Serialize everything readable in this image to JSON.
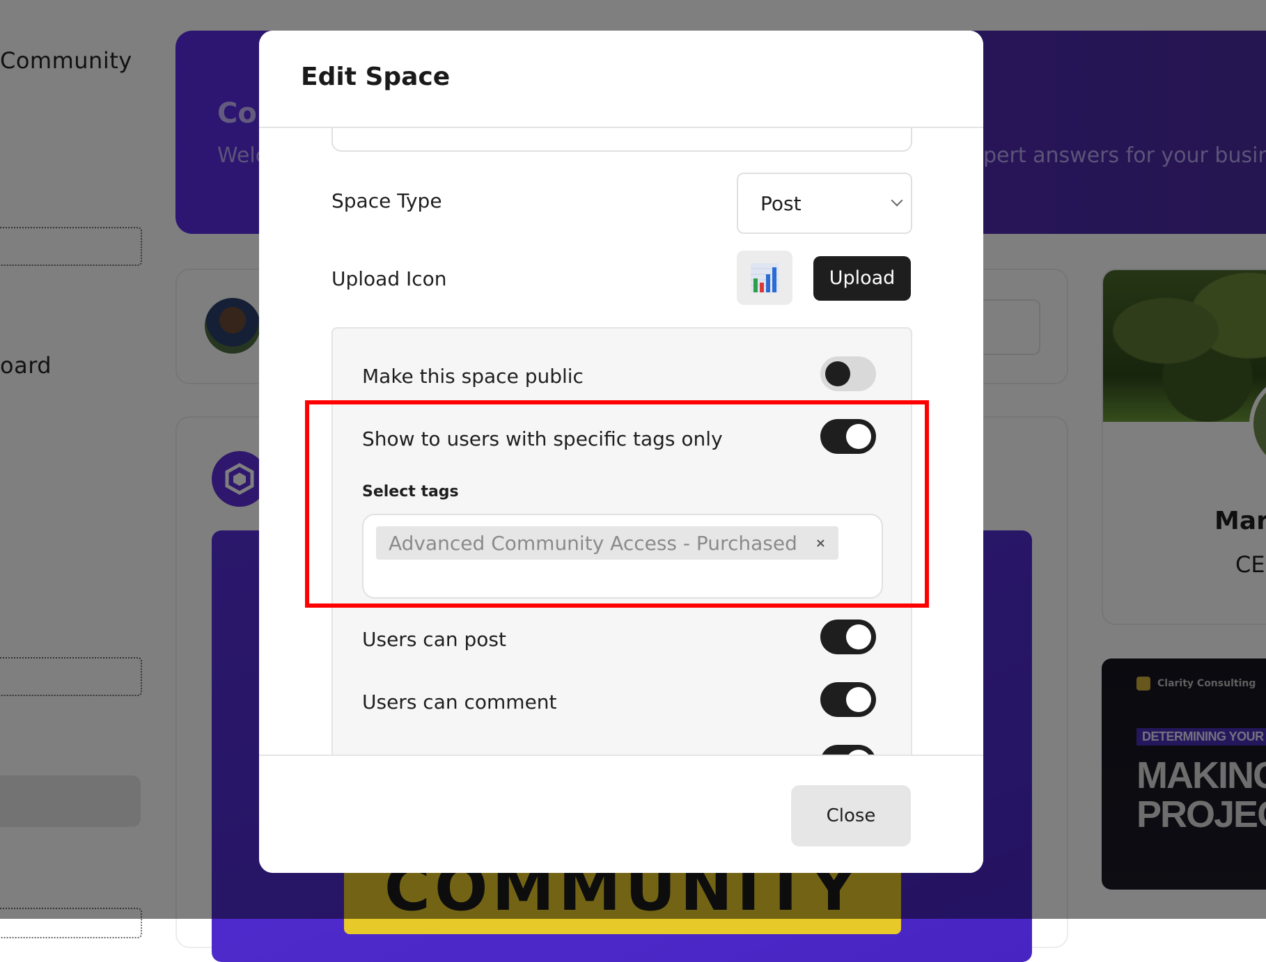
{
  "background": {
    "sidebar": {
      "community_label": "Community",
      "board_label": "oard"
    },
    "banner": {
      "title": "Co",
      "subtitle_left": "Welc",
      "subtitle_right": "pert answers for your busines"
    },
    "profile_card": {
      "name": "Marc",
      "role": "CEO"
    },
    "promo_card": {
      "brand": "Clarity Consulting",
      "tag": "DETERMINING YOUR BUSIN",
      "headline_line1": "MAKING R",
      "headline_line2": "PROJECTIO"
    },
    "yellow_bar_text": "COMMUNITY"
  },
  "modal": {
    "title": "Edit Space",
    "space_type": {
      "label": "Space Type",
      "value": "Post"
    },
    "upload_icon": {
      "label": "Upload Icon",
      "button_label": "Upload"
    },
    "toggles": [
      {
        "label": "Make this space public",
        "state": "off"
      },
      {
        "label": "Show to users with specific tags only",
        "state": "on"
      },
      {
        "label": "Users can post",
        "state": "on"
      },
      {
        "label": "Users can comment",
        "state": "on"
      }
    ],
    "select_tags": {
      "label": "Select tags",
      "selected": [
        "Advanced Community Access - Purchased"
      ],
      "remove_glyph": "×"
    },
    "footer": {
      "close_label": "Close"
    }
  },
  "colors": {
    "highlight": "#ff0000",
    "banner_purple": "#5b2ce6",
    "toggle_on": "#1e1e1e"
  }
}
